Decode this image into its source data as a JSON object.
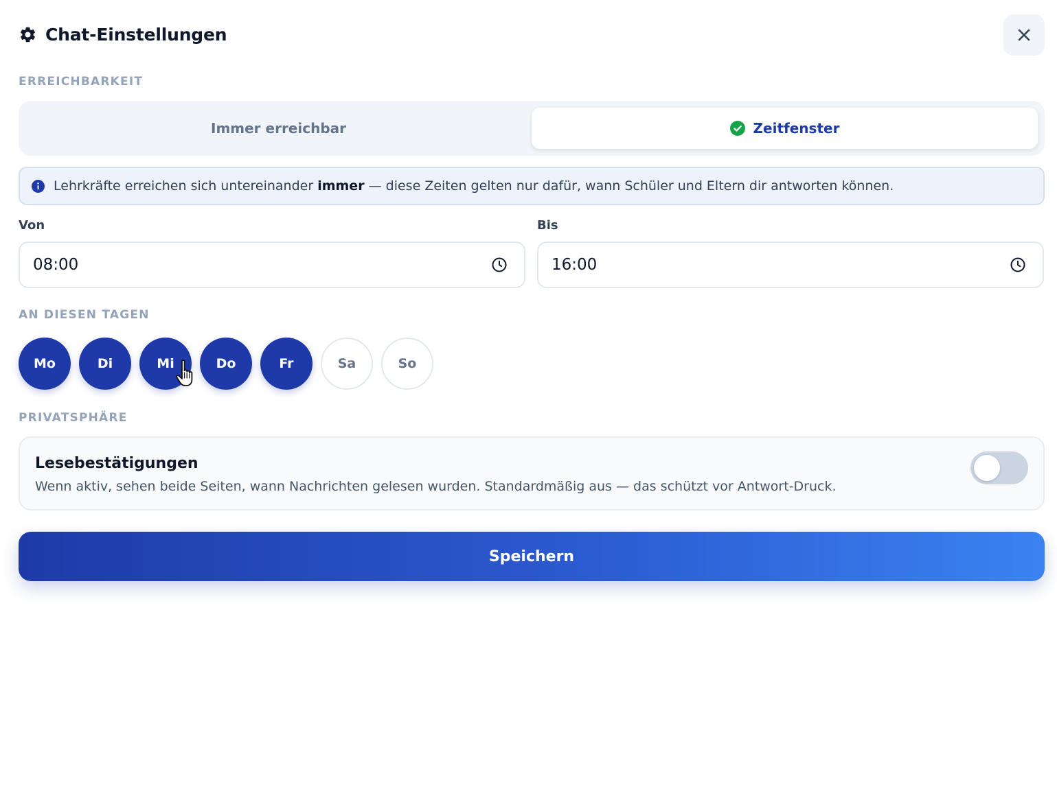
{
  "dialog": {
    "title": "Chat-Einstellungen",
    "icon": "gear-icon",
    "close_icon": "close-icon"
  },
  "availability": {
    "section_label": "ERREICHBARKEIT",
    "options": [
      {
        "label": "Immer erreichbar",
        "selected": false
      },
      {
        "label": "Zeitfenster",
        "selected": true,
        "icon": "check-circle-icon"
      }
    ],
    "info": {
      "icon": "info-icon",
      "text_before": "Lehrkräfte erreichen sich untereinander ",
      "text_bold": "immer",
      "text_after": " — diese Zeiten gelten nur dafür, wann Schüler und Eltern dir antworten können."
    }
  },
  "time": {
    "from_label": "Von",
    "from_value": "08:00",
    "to_label": "Bis",
    "to_value": "16:00",
    "icon": "clock-icon"
  },
  "days": {
    "section_label": "AN DIESEN TAGEN",
    "items": [
      {
        "label": "Mo",
        "active": true
      },
      {
        "label": "Di",
        "active": true
      },
      {
        "label": "Mi",
        "active": true
      },
      {
        "label": "Do",
        "active": true
      },
      {
        "label": "Fr",
        "active": true
      },
      {
        "label": "Sa",
        "active": false
      },
      {
        "label": "So",
        "active": false
      }
    ]
  },
  "privacy": {
    "section_label": "PRIVATSPHÄRE",
    "read_receipts": {
      "title": "Lesebestätigungen",
      "description": "Wenn aktiv, sehen beide Seiten, wann Nachrichten gelesen wurden. Standardmäßig aus — das schützt vor Antwort-Druck.",
      "enabled": false
    }
  },
  "save_label": "Speichern",
  "colors": {
    "primary": "#1e3aa8",
    "accent_gradient_end": "#3b82f0",
    "success": "#16a34a",
    "muted": "#94a3b8"
  }
}
